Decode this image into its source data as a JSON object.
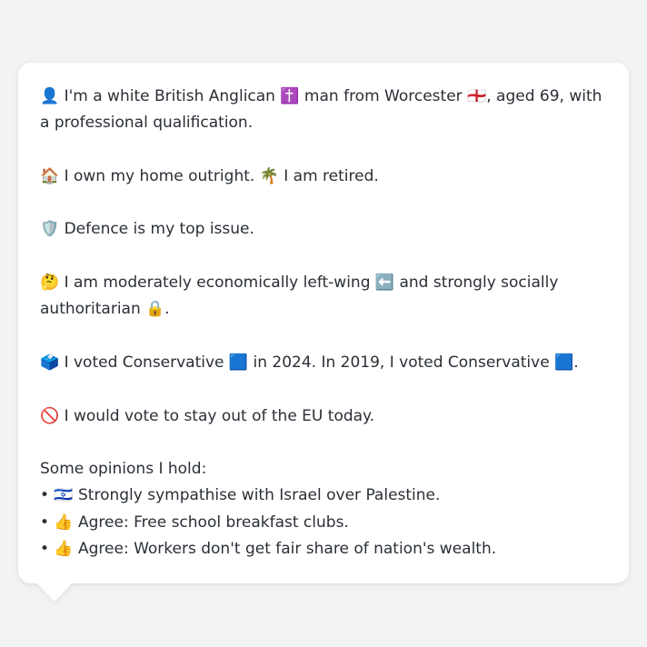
{
  "profile": {
    "p1": "👤 I'm a white British Anglican ✝️ man from Worcester 🏴󠁧󠁢󠁥󠁮󠁧󠁿, aged 69, with a professional qualification.",
    "p2": "🏠 I own my home outright. 🌴 I am retired.",
    "p3": "🛡️ Defence is my top issue.",
    "p4": "🤔 I am moderately economically left-wing ⬅️ and strongly socially authoritarian 🔒.",
    "p5": "🗳️ I voted Conservative 🟦 in 2024. In 2019, I voted Conservative 🟦.",
    "p6": "🚫 I would vote to stay out of the EU today.",
    "opinions_heading": "Some opinions I hold:",
    "opinions": [
      "• 🇮🇱 Strongly sympathise with Israel over Palestine.",
      "• 👍 Agree: Free school breakfast clubs.",
      "• 👍 Agree: Workers don't get fair share of nation's wealth."
    ]
  }
}
